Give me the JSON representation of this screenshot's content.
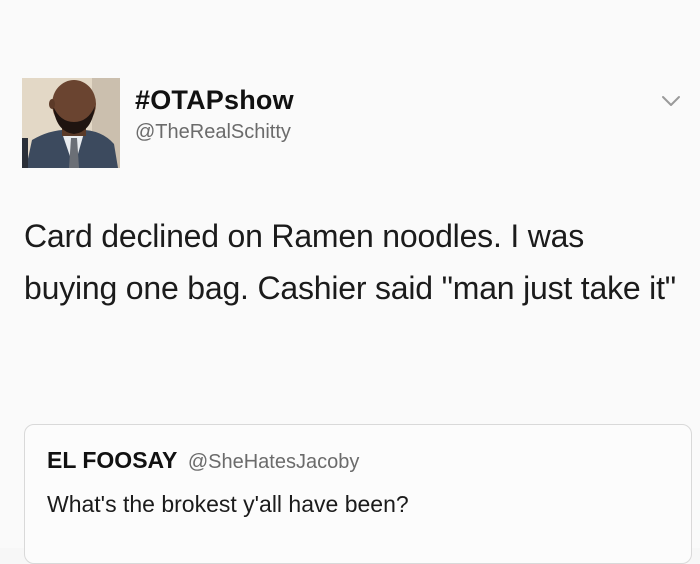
{
  "tweet": {
    "display_name": "#OTAPshow",
    "handle": "@TheRealSchitty",
    "text": "Card declined on Ramen noodles. I was buying one bag. Cashier said \"man just take it\"",
    "avatar_icon": "user-avatar",
    "menu_icon": "chevron-down-icon"
  },
  "quoted_tweet": {
    "display_name": "EL FOOSAY",
    "handle": "@SheHatesJacoby",
    "text": "What's the brokest y'all have been?"
  }
}
